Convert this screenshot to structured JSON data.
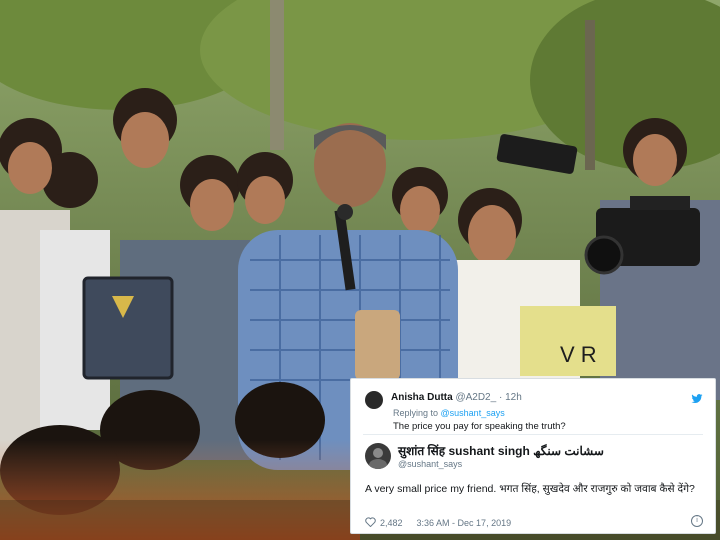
{
  "tweet": {
    "reply": {
      "name": "Anisha Dutta",
      "handle": "@A2D2_ · 12h",
      "replying_prefix": "Replying to ",
      "replying_to": "@sushant_says",
      "text": "The price you pay for speaking the truth?"
    },
    "main": {
      "name": "सुशांत सिंह sushant singh سشانت سنگھ",
      "handle": "@sushant_says",
      "text": "A very small price my friend. भगत सिंह, सुखदेव और राजगुरु को जवाब कैसे देंगे?",
      "likes": "2,482",
      "timestamp": "3:36 AM - Dec 17, 2019"
    },
    "colors": {
      "accent": "#1da1f2",
      "muted": "#657786",
      "text": "#14171a"
    },
    "icons": [
      "twitter-bird-icon",
      "heart-icon",
      "info-icon"
    ]
  },
  "photo": {
    "sign_text": "V R"
  }
}
